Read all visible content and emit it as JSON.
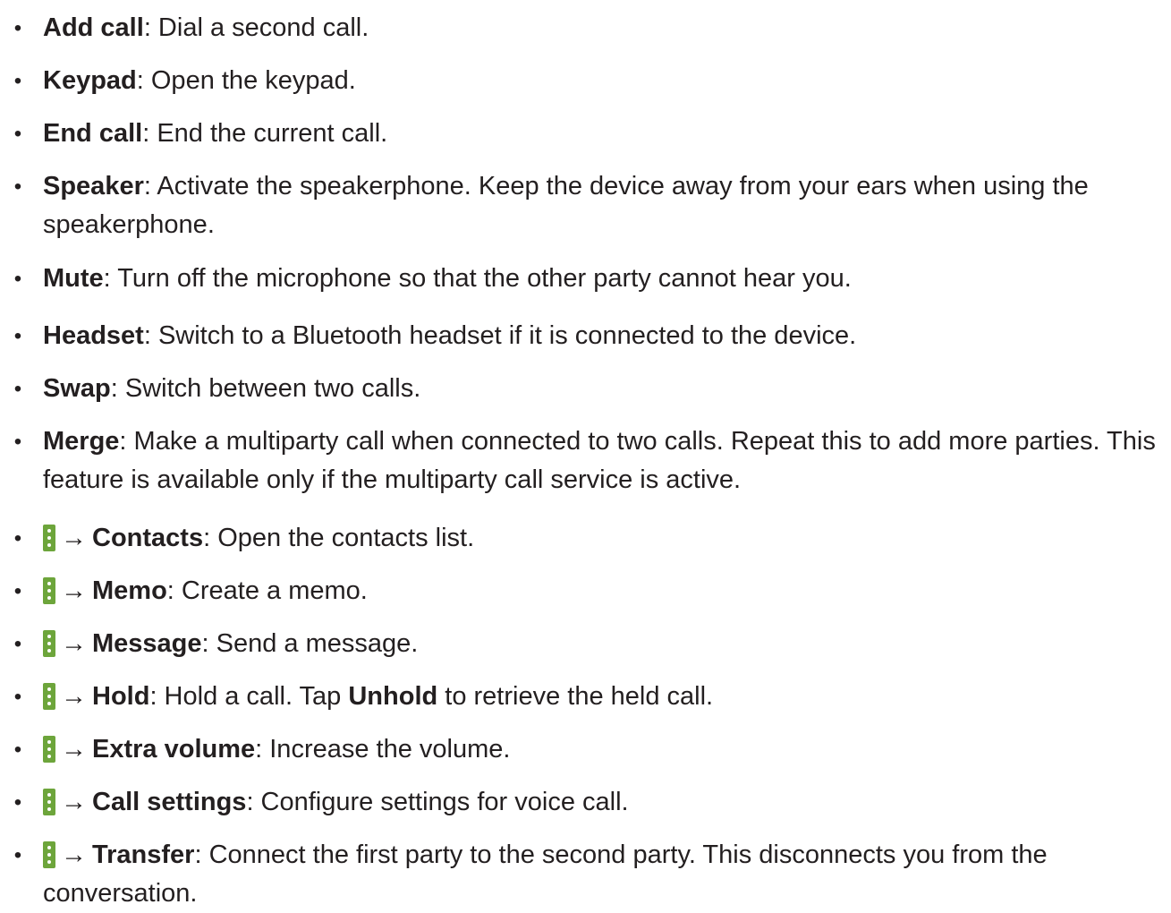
{
  "bullet": "•",
  "arrow": "→",
  "icon_name": "more-options-icon",
  "items": [
    {
      "term": "Add call",
      "desc": ": Dial a second call."
    },
    {
      "term": "Keypad",
      "desc": ": Open the keypad."
    },
    {
      "term": "End call",
      "desc": ": End the current call."
    },
    {
      "term": "Speaker",
      "desc": ": Activate the speakerphone. Keep the device away from your ears when using the speakerphone."
    },
    {
      "term": "Mute",
      "desc": ": Turn off the microphone so that the other party cannot hear you."
    },
    {
      "term": "Headset",
      "desc": ": Switch to a Bluetooth headset if it is connected to the device."
    },
    {
      "term": "Swap",
      "desc": ": Switch between two calls."
    },
    {
      "term": "Merge",
      "desc": ": Make a multiparty call when connected to two calls. Repeat this to add more parties. This feature is available only if the multiparty call service is active."
    },
    {
      "term": "Contacts",
      "desc": ": Open the contacts list."
    },
    {
      "term": "Memo",
      "desc": ": Create a memo."
    },
    {
      "term": "Message",
      "desc": ": Send a message."
    },
    {
      "term": "Hold",
      "desc": ": Hold a call. Tap ",
      "term2": "Unhold",
      "desc2": " to retrieve the held call."
    },
    {
      "term": "Extra volume",
      "desc": ": Increase the volume."
    },
    {
      "term": "Call settings",
      "desc": ": Configure settings for voice call."
    },
    {
      "term": "Transfer",
      "desc": ": Connect the first party to the second party. This disconnects you from the conversation."
    }
  ]
}
